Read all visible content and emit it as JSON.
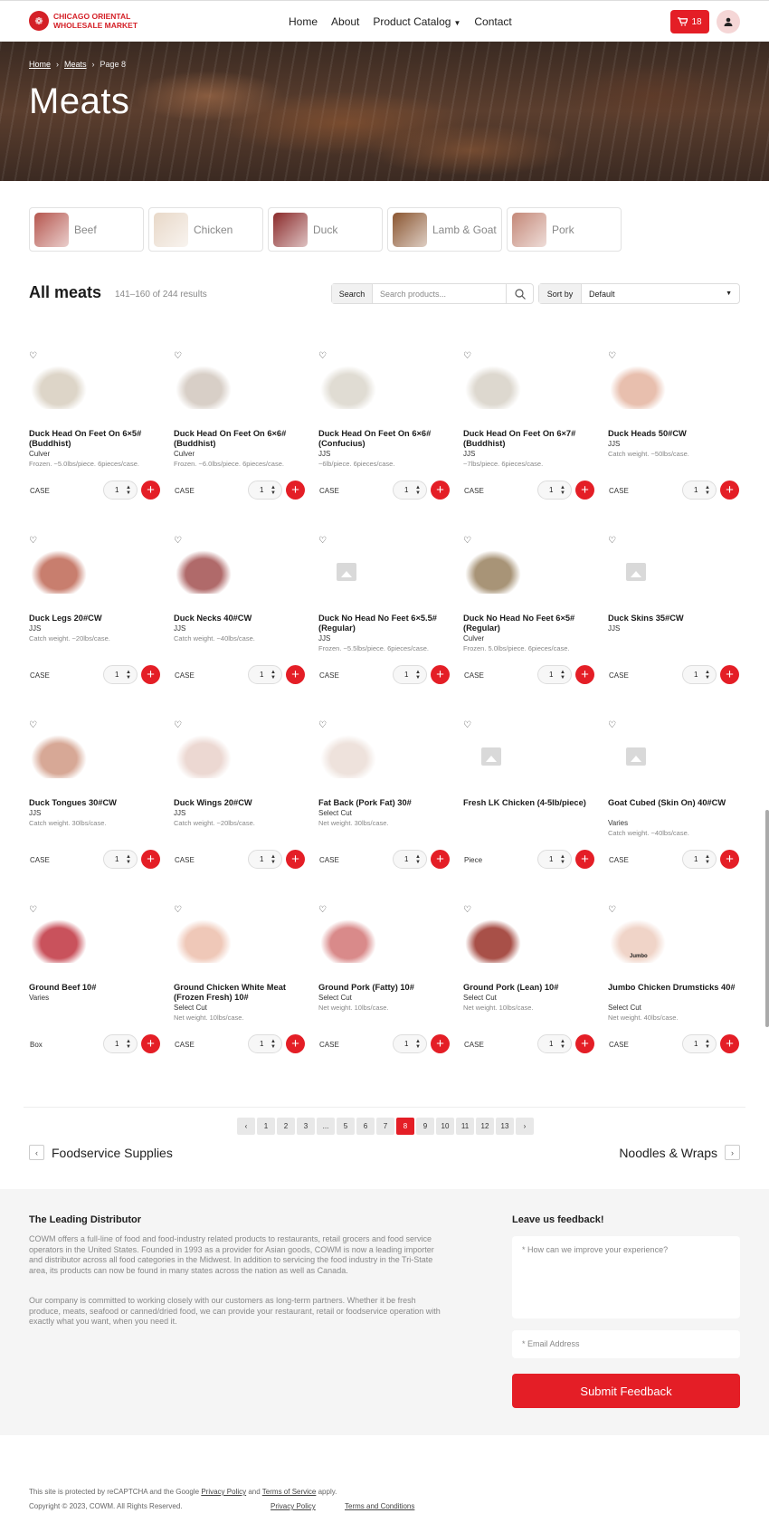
{
  "header": {
    "logo_glyph": "❁",
    "logo_line1": "CHICAGO ORIENTAL",
    "logo_line2": "WHOLESALE MARKET",
    "nav": [
      "Home",
      "About",
      "Product Catalog",
      "Contact"
    ],
    "cart_count": "18"
  },
  "hero": {
    "breadcrumbs": [
      "Home",
      "Meats",
      "Page 8"
    ],
    "title": "Meats"
  },
  "categories": [
    {
      "label": "Beef",
      "color": "#b5564e"
    },
    {
      "label": "Chicken",
      "color": "#e8d8c8"
    },
    {
      "label": "Duck",
      "color": "#8a2a2a"
    },
    {
      "label": "Lamb & Goat",
      "color": "#8a5530"
    },
    {
      "label": "Pork",
      "color": "#c48878"
    }
  ],
  "listing": {
    "title": "All meats",
    "count": "141–160 of 244 results",
    "search_label": "Search",
    "search_placeholder": "Search products...",
    "sort_label": "Sort by",
    "sort_value": "Default"
  },
  "products": [
    {
      "name": "Duck Head On Feet On 6×5# (Buddhist)",
      "brand": "Culver",
      "desc": "Frozen. ~5.0lbs/piece. 6pieces/case.",
      "unit": "CASE",
      "qty": "1",
      "img": "#ddd5c8"
    },
    {
      "name": "Duck Head On Feet On 6×6# (Buddhist)",
      "brand": "Culver",
      "desc": "Frozen. ~6.0lbs/piece. 6pieces/case.",
      "unit": "CASE",
      "qty": "1",
      "img": "#d8cfc7"
    },
    {
      "name": "Duck Head On Feet On 6×6# (Confucius)",
      "brand": "JJS",
      "desc": "~6lb/piece. 6pieces/case.",
      "unit": "CASE",
      "qty": "1",
      "img": "#e0dcd3"
    },
    {
      "name": "Duck Head On Feet On 6×7# (Buddhist)",
      "brand": "JJS",
      "desc": "~7lbs/piece. 6pieces/case.",
      "unit": "CASE",
      "qty": "1",
      "img": "#ddd8cf"
    },
    {
      "name": "Duck Heads 50#CW",
      "brand": "JJS",
      "desc": "Catch weight. ~50lbs/case.",
      "unit": "CASE",
      "qty": "1",
      "img": "#e8bfae"
    },
    {
      "name": "Duck Legs 20#CW",
      "brand": "JJS",
      "desc": "Catch weight. ~20lbs/case.",
      "unit": "CASE",
      "qty": "1",
      "img": "#c87e6e"
    },
    {
      "name": "Duck Necks 40#CW",
      "brand": "JJS",
      "desc": "Catch weight. ~40lbs/case.",
      "unit": "CASE",
      "qty": "1",
      "img": "#b06a6a"
    },
    {
      "name": "Duck No Head No Feet 6×5.5# (Regular)",
      "brand": "JJS",
      "desc": "Frozen. ~5.5lbs/piece. 6pieces/case.",
      "unit": "CASE",
      "qty": "1",
      "img": ""
    },
    {
      "name": "Duck No Head No Feet 6×5# (Regular)",
      "brand": "Culver",
      "desc": "Frozen. 5.0lbs/piece. 6pieces/case.",
      "unit": "CASE",
      "qty": "1",
      "img": "#a89477"
    },
    {
      "name": "Duck Skins 35#CW",
      "brand": "JJS",
      "desc": "",
      "unit": "CASE",
      "qty": "1",
      "img": ""
    },
    {
      "name": "Duck Tongues 30#CW",
      "brand": "JJS",
      "desc": "Catch weight. 30lbs/case.",
      "unit": "CASE",
      "qty": "1",
      "img": "#d7a896"
    },
    {
      "name": "Duck Wings 20#CW",
      "brand": "JJS",
      "desc": "Catch weight. ~20lbs/case.",
      "unit": "CASE",
      "qty": "1",
      "img": "#ecd8d2"
    },
    {
      "name": "Fat Back (Pork Fat) 30#",
      "brand": "Select Cut",
      "desc": "Net weight. 30lbs/case.",
      "unit": "CASE",
      "qty": "1",
      "img": "#eee2dc"
    },
    {
      "name": "Fresh LK Chicken (4-5lb/piece)",
      "brand": "",
      "desc": "",
      "unit": "Piece",
      "qty": "1",
      "img": ""
    },
    {
      "name": "Goat Cubed (Skin On) 40#CW",
      "brand": "Varies",
      "desc": "Catch weight. ~40lbs/case.",
      "unit": "CASE",
      "qty": "1",
      "img": ""
    },
    {
      "name": "Ground Beef 10#",
      "brand": "Varies",
      "desc": "",
      "unit": "Box",
      "qty": "1",
      "img": "#c9525c"
    },
    {
      "name": "Ground Chicken White Meat (Frozen Fresh) 10#",
      "brand": "Select Cut",
      "desc": "Net weight. 10lbs/case.",
      "unit": "CASE",
      "qty": "1",
      "img": "#efc8b8"
    },
    {
      "name": "Ground Pork (Fatty) 10#",
      "brand": "Select Cut",
      "desc": "Net weight. 10lbs/case.",
      "unit": "CASE",
      "qty": "1",
      "img": "#d98a8a"
    },
    {
      "name": "Ground Pork (Lean) 10#",
      "brand": "Select Cut",
      "desc": "Net weight. 10lbs/case.",
      "unit": "CASE",
      "qty": "1",
      "img": "#a85048"
    },
    {
      "name": "Jumbo Chicken Drumsticks 40#",
      "brand": "Select Cut",
      "desc": "Net weight. 40lbs/case.",
      "unit": "CASE",
      "qty": "1",
      "img": "#f0d4c8",
      "img_caption": "Jumbo"
    }
  ],
  "pagination": [
    "‹",
    "1",
    "2",
    "3",
    "...",
    "5",
    "6",
    "7",
    "8",
    "9",
    "10",
    "11",
    "12",
    "13",
    "›"
  ],
  "current_page": "8",
  "prev_category": "Foodservice Supplies",
  "next_category": "Noodles & Wraps",
  "footer": {
    "title": "The Leading Distributor",
    "p1": "COWM offers a full-line of food and food-industry related products to restaurants, retail grocers and food service operators in the United States. Founded in 1993 as a provider for Asian goods, COWM is now a leading importer and distributor across all food categories in the Midwest. In addition to servicing the food industry in the Tri-State area, its products can now be found in many states across the nation as well as Canada.",
    "p2": "Our company is committed to working closely with our customers as long-term partners. Whether it be fresh produce, meats, seafood or canned/dried food, we can provide your restaurant, retail or foodservice operation with exactly what you want, when you need it.",
    "feedback_title": "Leave us feedback!",
    "feedback_placeholder": "* How can we improve your experience?",
    "email_placeholder": "* Email Address",
    "submit_label": "Submit Feedback"
  },
  "legal": {
    "recaptcha_pre": "This site is protected by reCAPTCHA and the Google",
    "privacy": "Privacy Policy",
    "and": "and",
    "terms": "Terms of Service",
    "apply": "apply.",
    "copyright": "Copyright © 2023, COWM. All Rights Reserved.",
    "privacy2": "Privacy Policy",
    "terms2": "Terms and Conditions"
  }
}
